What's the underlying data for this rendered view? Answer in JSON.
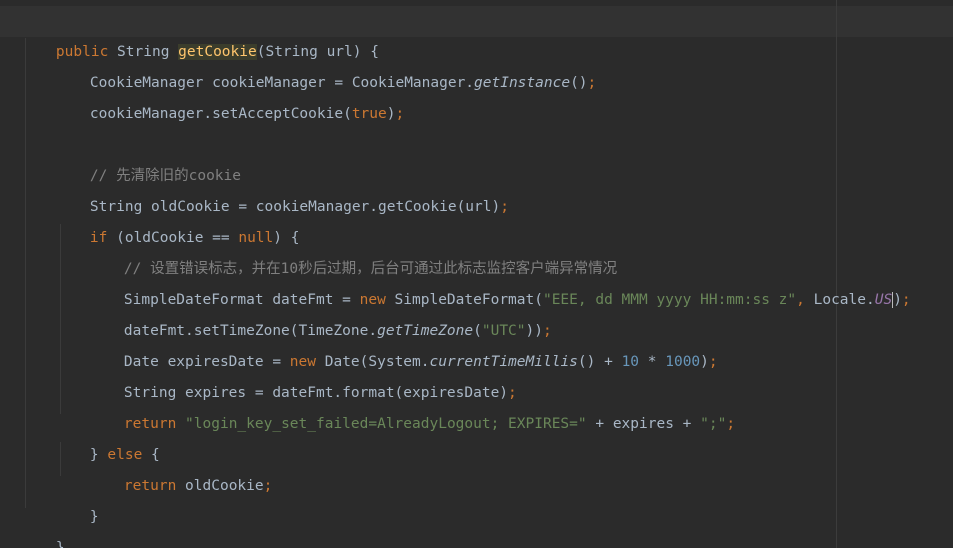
{
  "code": {
    "l1": {
      "kw_public": "public",
      "t1": " String ",
      "method": "getCookie",
      "t2": "(String url) {"
    },
    "l2": {
      "t1": "CookieManager cookieManager = CookieManager.",
      "m": "getInstance",
      "t2": "()",
      "semi": ";"
    },
    "l3": {
      "t1": "cookieManager.setAcceptCookie(",
      "kw": "true",
      "t2": ")",
      "semi": ";"
    },
    "l5": {
      "comment": "// 先清除旧的cookie"
    },
    "l6": {
      "t1": "String oldCookie = cookieManager.getCookie(url)",
      "semi": ";"
    },
    "l7": {
      "kw_if": "if",
      "t1": " (oldCookie == ",
      "kw_null": "null",
      "t2": ") {"
    },
    "l8": {
      "comment": "// 设置错误标志，并在10秒后过期，后台可通过此标志监控客户端异常情况"
    },
    "l9": {
      "t1": "SimpleDateFormat dateFmt = ",
      "kw_new": "new",
      "t2": " SimpleDateFormat(",
      "str": "\"EEE, dd MMM yyyy HH:mm:ss z\"",
      "comma": ",",
      "t3": " Locale.",
      "field": "US",
      "t4": ")",
      "semi": ";"
    },
    "l10": {
      "t1": "dateFmt.setTimeZone(TimeZone.",
      "m": "getTimeZone",
      "t2": "(",
      "str": "\"UTC\"",
      "t3": "))",
      "semi": ";"
    },
    "l11": {
      "t1": "Date expiresDate = ",
      "kw_new": "new",
      "t2": " Date(System.",
      "m": "currentTimeMillis",
      "t3": "() + ",
      "n1": "10",
      "t4": " * ",
      "n2": "1000",
      "t5": ")",
      "semi": ";"
    },
    "l12": {
      "t1": "String expires = dateFmt.format(expiresDate)",
      "semi": ";"
    },
    "l13": {
      "kw_return": "return",
      "sp": " ",
      "str1": "\"login_key_set_failed=AlreadyLogout; EXPIRES=\"",
      "t1": " + expires + ",
      "str2": "\";\"",
      "semi": ";"
    },
    "l14": {
      "t1": "} ",
      "kw_else": "else",
      "t2": " {"
    },
    "l15": {
      "kw_return": "return",
      "t1": " oldCookie",
      "semi": ";"
    },
    "l16": {
      "t1": "}"
    },
    "l17": {
      "t1": "}"
    }
  },
  "colors": {
    "background": "#2b2b2b",
    "keyword": "#cc7832",
    "string": "#6a8759",
    "number": "#6897bb",
    "comment": "#808080",
    "method_decl": "#ffc66d",
    "static_field": "#9876aa",
    "text": "#a9b7c6"
  }
}
